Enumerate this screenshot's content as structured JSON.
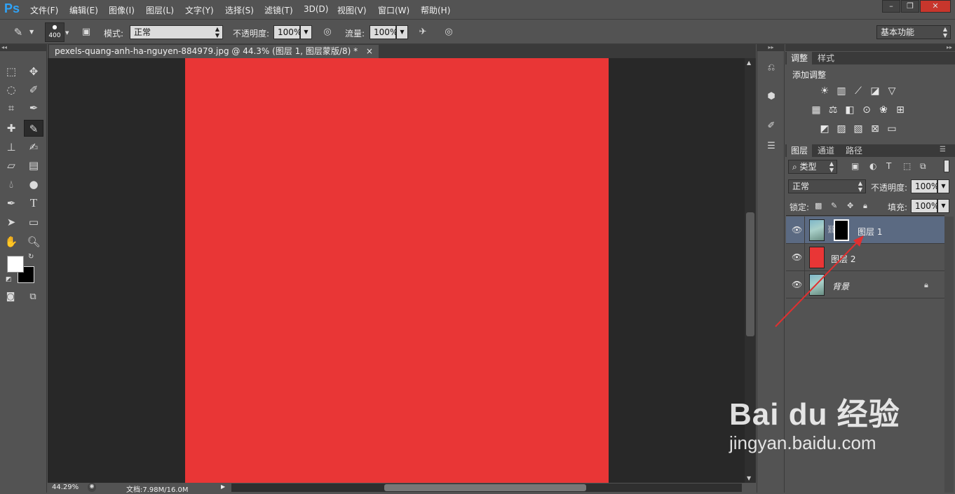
{
  "app": {
    "logo": "Ps",
    "accent": "#2fa3f7"
  },
  "menu": [
    "文件(F)",
    "编辑(E)",
    "图像(I)",
    "图层(L)",
    "文字(Y)",
    "选择(S)",
    "滤镜(T)",
    "3D(D)",
    "视图(V)",
    "窗口(W)",
    "帮助(H)"
  ],
  "window_controls": [
    "–",
    "❐",
    "✕"
  ],
  "options": {
    "brush_size": "400",
    "mode_label": "模式:",
    "mode_value": "正常",
    "opacity_label": "不透明度:",
    "opacity_value": "100%",
    "flow_label": "流量:",
    "flow_value": "100%",
    "workspace": "基本功能"
  },
  "document": {
    "tab_title": "pexels-quang-anh-ha-nguyen-884979.jpg @ 44.3% (图层 1, 图层蒙版/8) *",
    "close": "×",
    "canvas_color": "#e93636",
    "zoom": "44.29%",
    "doc_info": "文档:7.98M/16.0M"
  },
  "adjustments_panel": {
    "tabs": [
      "调整",
      "样式"
    ],
    "title": "添加调整",
    "rows": [
      [
        "brightness-icon",
        "levels-icon",
        "curves-icon",
        "exposure-icon",
        "vibrance-icon"
      ],
      [
        "hue-saturation-icon",
        "color-balance-icon",
        "black-white-icon",
        "photo-filter-icon",
        "channel-mixer-icon",
        "color-lookup-icon"
      ],
      [
        "invert-icon",
        "posterize-icon",
        "threshold-icon",
        "selective-color-icon",
        "gradient-map-icon"
      ]
    ]
  },
  "layers_panel": {
    "tabs": [
      "图层",
      "通道",
      "路径"
    ],
    "filter_label": "类型",
    "blend_mode": "正常",
    "opacity_label": "不透明度:",
    "opacity_value": "100%",
    "lock_label": "锁定:",
    "fill_label": "填充:",
    "fill_value": "100%",
    "layers": [
      {
        "name": "图层 1",
        "selected": true,
        "has_mask": true
      },
      {
        "name": "图层 2",
        "selected": false,
        "thumb_color": "#e93636"
      },
      {
        "name": "背景",
        "selected": false,
        "locked": true
      }
    ]
  },
  "watermark": {
    "brand": "Bai du 经验",
    "url": "jingyan.baidu.com"
  },
  "annotation_color": "#e03030"
}
